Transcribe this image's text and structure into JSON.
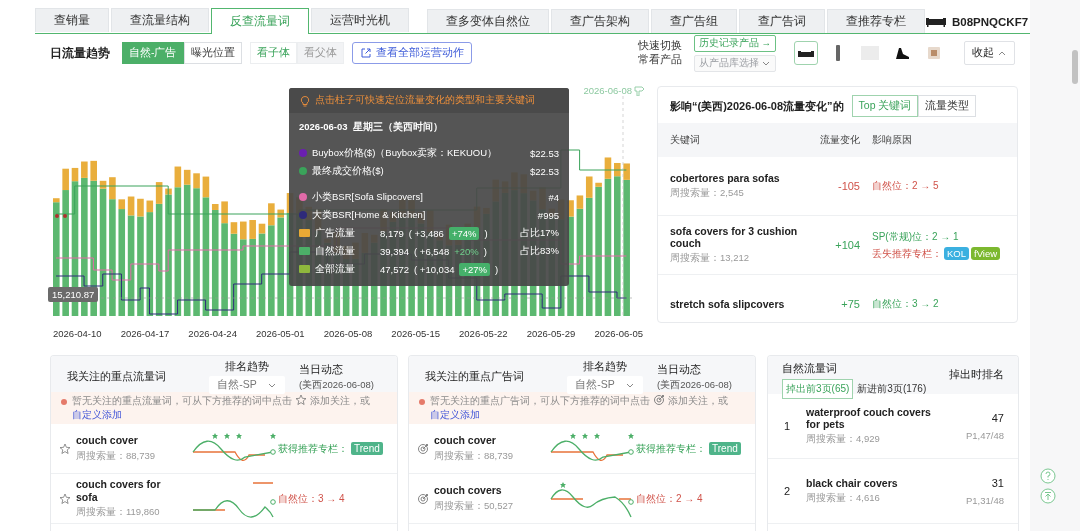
{
  "tabs": [
    [
      {
        "label": "查销量",
        "selected": false
      },
      {
        "label": "查流量结构",
        "selected": false
      },
      {
        "label": "反查流量词",
        "selected": true
      },
      {
        "label": "运营时光机",
        "selected": false
      }
    ],
    [
      {
        "label": "查多变体自然位",
        "selected": false
      },
      {
        "label": "查广告架构",
        "selected": false
      },
      {
        "label": "查广告组",
        "selected": false
      },
      {
        "label": "查广告词",
        "selected": false
      },
      {
        "label": "查推荐专栏",
        "selected": false
      }
    ]
  ],
  "product": {
    "asin": "B08PNQCKF7"
  },
  "toolbar": {
    "title": "日流量趋势",
    "traffic_toggle": [
      {
        "label": "自然-广告",
        "selected": true
      },
      {
        "label": "曝光位置",
        "selected": false
      }
    ],
    "variant_toggle": [
      {
        "label": "看子体",
        "selected": true
      },
      {
        "label": "看父体",
        "selected": false
      }
    ],
    "actions_button": "查看全部运营动作",
    "quick_switch_label": "快速切换常看产品",
    "history_button": "历史记录产品 →",
    "library_select": {
      "label": "从产品库选择",
      "disabled": true
    },
    "product_thumbnails": [
      {
        "selected": true
      },
      {
        "selected": false
      },
      {
        "selected": false
      },
      {
        "selected": false
      },
      {
        "selected": false
      }
    ],
    "collapse_button": "收起"
  },
  "chart": {
    "x_labels": [
      "2026-04-10",
      "2026-04-17",
      "2026-04-24",
      "2026-05-01",
      "2026-05-08",
      "2026-05-15",
      "2026-05-22",
      "2026-05-29",
      "2026-06-05"
    ],
    "marker_date": "2026-06-08",
    "crosshair_value": "15,210.87",
    "tooltip": {
      "hint": "点击柱子可快速定位流量变化的类型和主要关键词",
      "date": "2026-06-03  星期三（美西时间）",
      "rows": [
        {
          "kind": "metric",
          "color": "#6a1fb0",
          "label": "Buybox价格($)（Buybox卖家：KEKUOU）",
          "value": "$22.53"
        },
        {
          "kind": "metric",
          "color": "#3aa35a",
          "label": "最终成交价格($)",
          "value": "$22.53"
        },
        {
          "kind": "gap"
        },
        {
          "kind": "metric",
          "color": "#e06aa8",
          "label": "小类BSR[Sofa Slipcovers]",
          "value": "#4"
        },
        {
          "kind": "metric",
          "color": "#2e2a7a",
          "label": "大类BSR[Home & Kitchen]",
          "value": "#995"
        },
        {
          "kind": "traffic",
          "color": "#e8a935",
          "label": "广告流量",
          "value": "8,179",
          "change": "( +3,486",
          "pct": "+74%",
          "close": ")",
          "badge": true,
          "share": "占比17%"
        },
        {
          "kind": "traffic",
          "color": "#4caf68",
          "label": "自然流量",
          "value": "39,394",
          "change": "( +6,548",
          "pct": "+20%",
          "close": ")",
          "badge": false,
          "share": "占比83%"
        },
        {
          "kind": "traffic",
          "color": "#8fb83d",
          "label": "全部流量",
          "value": "47,572",
          "change": "( +10,034",
          "pct": "+27%",
          "close": ")",
          "badge": true
        }
      ]
    }
  },
  "impact_panel": {
    "title": "影响“(美西)2026-06-08流量变化”的",
    "tabs": [
      {
        "label": "Top 关键词",
        "selected": true
      },
      {
        "label": "流量类型",
        "selected": false
      }
    ],
    "columns": [
      "关键词",
      "流量变化",
      "影响原因"
    ],
    "rows": [
      {
        "keyword": "cobertores para sofas",
        "volume": "周搜索量：2,545",
        "change": "-105",
        "negative": true,
        "reasons": [
          {
            "text": "自然位：2 → 5",
            "negative": true
          }
        ]
      },
      {
        "keyword": "sofa covers for 3 cushion couch",
        "volume": "周搜索量：13,212",
        "change": "+104",
        "negative": false,
        "reasons": [
          {
            "text": "SP(常规)位：2 → 1",
            "negative": false
          },
          {
            "text": "丢失推荐专栏：",
            "negative": true,
            "tags": [
              {
                "label": "KOL",
                "color": "#3bb0e0"
              },
              {
                "label": "fView",
                "color": "#7cb82f"
              }
            ]
          }
        ]
      },
      {
        "keyword": "stretch sofa slipcovers",
        "change": "+75",
        "negative": false,
        "reasons": [
          {
            "text": "自然位：3 → 2",
            "negative": false
          }
        ]
      }
    ]
  },
  "watch_cards": [
    {
      "kind": "organic",
      "title": "我关注的重点流量词",
      "trend_header": "排名趋势",
      "select_value": "自然-SP",
      "day_header": "当日动态",
      "day_sub": "(美西2026-06-08)",
      "notice": {
        "before": "暂无关注的重点流量词，可从下方推荐的词中点击",
        "after": "添加关注，或",
        "link": "自定义添加"
      },
      "rows": [
        {
          "keyword": "couch cover",
          "volume": "周搜索量：88,739",
          "status": {
            "kind": "column",
            "text": "获得推荐专栏：",
            "tag": "Trend"
          }
        },
        {
          "keyword": "couch covers for sofa",
          "volume": "周搜索量：119,860",
          "status": {
            "kind": "rank",
            "text": "自然位：3 → 4"
          }
        }
      ]
    },
    {
      "kind": "ad",
      "title": "我关注的重点广告词",
      "trend_header": "排名趋势",
      "select_value": "自然-SP",
      "day_header": "当日动态",
      "day_sub": "(美西2026-06-08)",
      "notice": {
        "before": "暂无关注的重点广告词，可从下方推荐的词中点击",
        "after": "添加关注，或",
        "link": "自定义添加"
      },
      "rows": [
        {
          "keyword": "couch cover",
          "volume": "周搜索量：88,739",
          "status": {
            "kind": "column",
            "text": "获得推荐专栏：",
            "tag": "Trend"
          }
        },
        {
          "keyword": "couch covers",
          "volume": "周搜索量：50,527",
          "status": {
            "kind": "rank",
            "text": "自然位：2 → 4"
          }
        }
      ]
    }
  ],
  "organic_card": {
    "title": "自然流量词",
    "tabs": [
      {
        "label": "掉出前3页(65)",
        "selected": true
      },
      {
        "label": "新进前3页(176)",
        "selected": false
      }
    ],
    "rank_header": "掉出时排名",
    "rows": [
      {
        "no": "1",
        "keyword": "waterproof couch covers for pets",
        "volume": "周搜索量：4,929",
        "rank": "47",
        "page": "P1,47/48"
      },
      {
        "no": "2",
        "keyword": "black chair covers",
        "volume": "周搜索量：4,616",
        "rank": "31",
        "page": "P1,31/48"
      }
    ]
  }
}
